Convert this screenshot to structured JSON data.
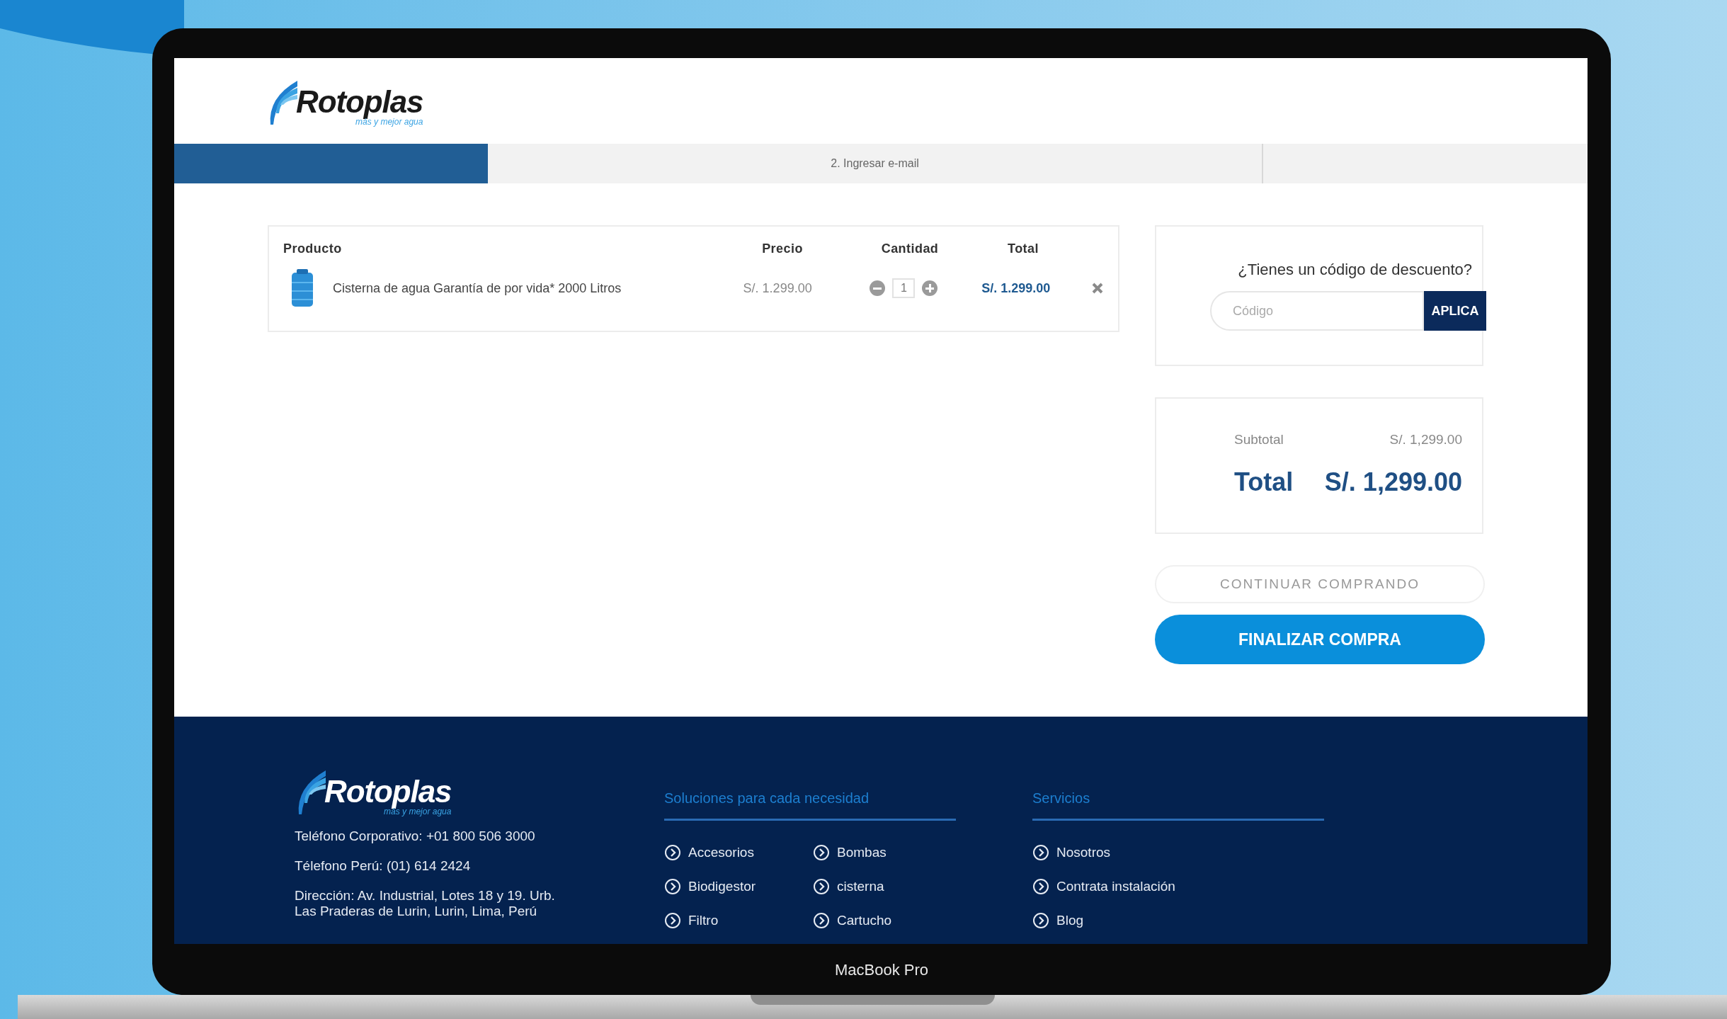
{
  "header": {
    "logo": {
      "name": "Rotoplas",
      "tagline": "más y mejor agua"
    }
  },
  "checkout_steps": [
    {
      "selected": true
    },
    {
      "label": "2. Ingresar e-mail",
      "selected": false
    },
    {
      "selected": false
    }
  ],
  "cart": {
    "columns": [
      "Producto",
      "Precio",
      "Cantidad",
      "Total"
    ],
    "rows": [
      {
        "product": "Cisterna de agua Garantía de por vida* 2000 Litros",
        "price": "S/. 1.299.00",
        "quantity": "1",
        "total": "S/. 1.299.00"
      }
    ]
  },
  "discount": {
    "prompt": "¿Tienes un código de descuento?",
    "placeholder": "Código",
    "button": "APLICA"
  },
  "summary": {
    "subtotal_label": "Subtotal",
    "subtotal": "S/. 1,299.00",
    "total_label": "Total",
    "total": "S/. 1,299.00"
  },
  "actions": [
    {
      "kind": "outline",
      "label": "CONTINUAR COMPRANDO"
    },
    {
      "kind": "primary",
      "label": "FINALIZAR COMPRA"
    }
  ],
  "footer": {
    "logo": {
      "name": "Rotoplas",
      "tagline": "más y mejor agua"
    },
    "contact": [
      "Teléfono Corporativo: +01 800 506 3000",
      "Télefono Perú: (01) 614 2424",
      "Dirección: Av. Industrial, Lotes 18 y 19. Urb. Las Praderas de Lurin, Lurin, Lima, Perú"
    ],
    "columns": [
      {
        "title": "Soluciones para cada necesidad",
        "links": [
          "Accesorios",
          "Bombas",
          "Biodigestor",
          "cisterna",
          "Filtro",
          "Cartucho"
        ]
      },
      {
        "title": "Servicios",
        "links": [
          "Nosotros",
          "Contrata instalación",
          "Blog"
        ]
      }
    ]
  },
  "device_label": "MacBook Pro"
}
